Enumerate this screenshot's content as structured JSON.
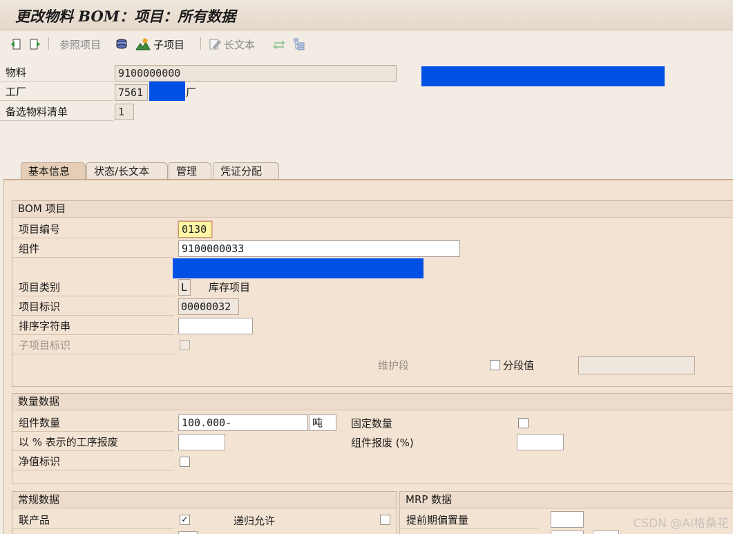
{
  "window": {
    "title": "更改物料 BOM：项目：所有数据"
  },
  "toolbar": {
    "ref_item_label": "参照项目",
    "sub_item_label": "子项目",
    "long_text_label": "长文本"
  },
  "header": {
    "material_label": "物料",
    "material_value": "9100000000",
    "plant_label": "工厂",
    "plant_value": "7561",
    "plant_suffix": "厂",
    "alt_bom_label": "备选物料清单",
    "alt_bom_value": "1"
  },
  "tabs": [
    {
      "label": "基本信息"
    },
    {
      "label": "状态/长文本"
    },
    {
      "label": "管理"
    },
    {
      "label": "凭证分配"
    }
  ],
  "bom_item": {
    "heading": "BOM 项目",
    "item_no_label": "项目编号",
    "item_no_value": "0130",
    "component_label": "组件",
    "component_value": "9100000033",
    "item_category_label": "项目类别",
    "item_category_value": "L",
    "item_category_text": "库存项目",
    "item_id_label": "项目标识",
    "item_id_value": "00000032",
    "sort_string_label": "排序字符串",
    "sort_string_value": "",
    "sub_item_id_label": "子项目标识",
    "maint_section_label": "维护段",
    "section_value_label": "分段值",
    "section_value_value": ""
  },
  "quantity": {
    "heading": "数量数据",
    "comp_qty_label": "组件数量",
    "comp_qty_value": "100.000-",
    "unit_value": "吨",
    "fixed_qty_label": "固定数量",
    "op_scrap_label": "以 % 表示的工序报废",
    "op_scrap_value": "",
    "comp_scrap_label": "组件报废 (%)",
    "comp_scrap_value": "",
    "net_id_label": "净值标识"
  },
  "general": {
    "heading": "常规数据",
    "coproduct_label": "联产品",
    "coproduct_checked": true,
    "recursive_label": "递归允许",
    "row2_label": "",
    "row2_right_label": ""
  },
  "mrp": {
    "heading": "MRP 数据",
    "lead_offset_label": "提前期偏置量",
    "lead_offset_value": "",
    "row2_label": ""
  },
  "watermark": "CSDN @AI格桑花",
  "colors": {
    "redaction": "#0050e6",
    "panel": "#f3e3d3",
    "active_tab": "#e6cdb5"
  }
}
